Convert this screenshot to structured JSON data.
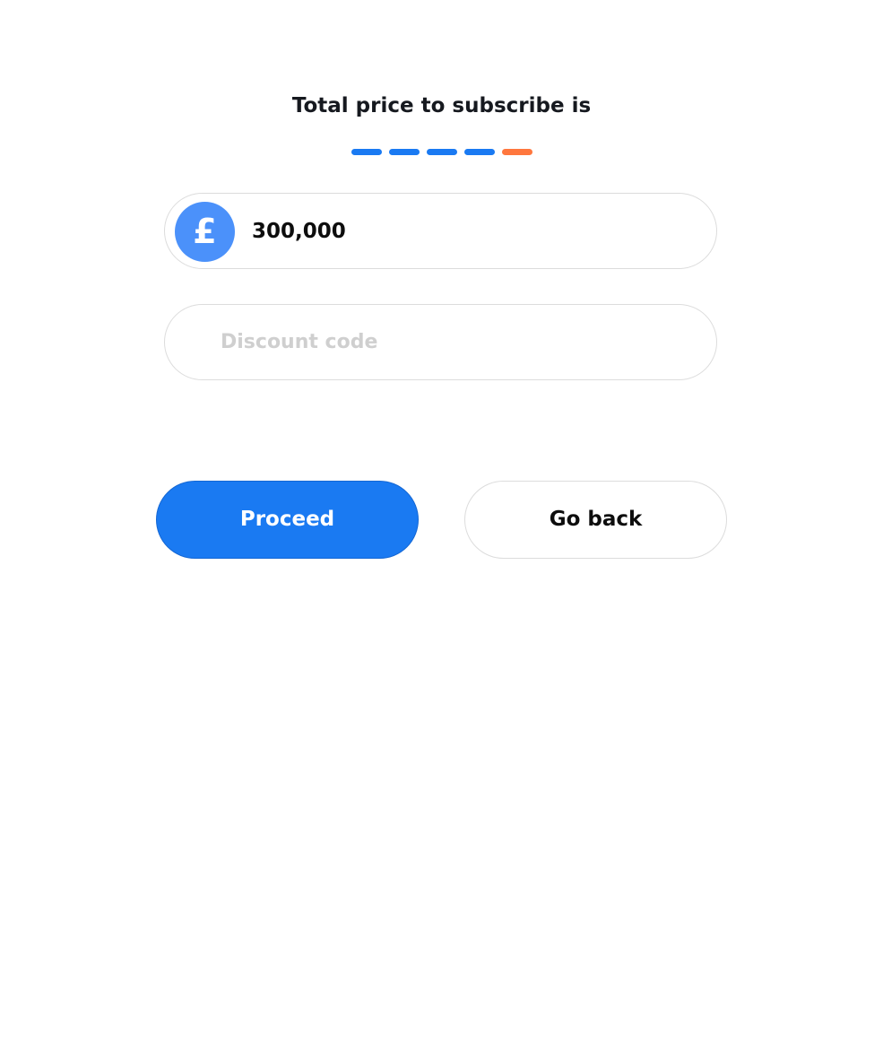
{
  "header": {
    "title": "Total price to subscribe is"
  },
  "progress": {
    "total_steps": 5,
    "current_step": 5,
    "completed_color": "#1a7af2",
    "current_color": "#ff773e"
  },
  "price_field": {
    "currency_symbol": "£",
    "currency_icon": "pound-sign-icon",
    "value": "300,000"
  },
  "discount_field": {
    "value": "",
    "placeholder": "Discount code"
  },
  "actions": {
    "proceed_label": "Proceed",
    "go_back_label": "Go back",
    "accent_color": "#1a7af2"
  }
}
